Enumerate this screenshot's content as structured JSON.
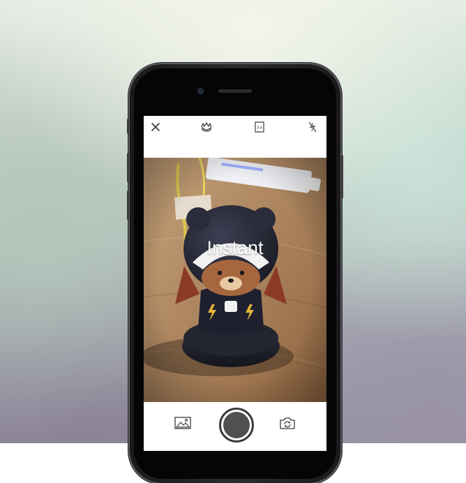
{
  "app": {
    "mode_label": "Instant",
    "aspect_ratio_label": "3:4"
  },
  "toolbar": {
    "close_icon": "close-icon",
    "filter_icon": "bear-paw-icon",
    "aspect_icon": "aspect-ratio-icon",
    "flash_icon": "flash-off-icon"
  },
  "bottom_bar": {
    "gallery_icon": "gallery-icon",
    "shutter": "shutter-button",
    "switch_camera_icon": "switch-camera-icon"
  },
  "colors": {
    "icon": "#3a3a3a",
    "shutter_ring": "#3a3a3a",
    "shutter_fill": "#505050",
    "screen_bg": "#ffffff"
  }
}
